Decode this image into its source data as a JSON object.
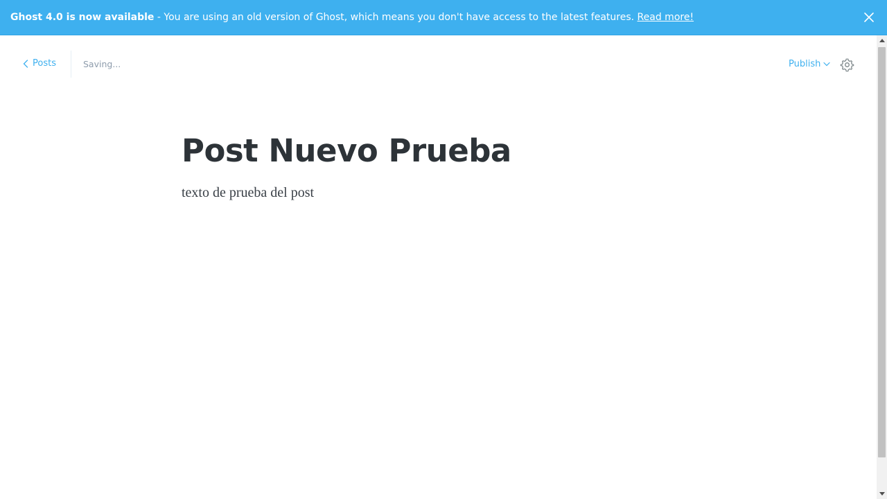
{
  "banner": {
    "bold_text": "Ghost 4.0 is now available",
    "message": " - You are using an old version of Ghost, which means you don't have access to the latest features. ",
    "link_text": "Read more!",
    "close_icon": "close-icon",
    "background_color": "#3eb0ef"
  },
  "topbar": {
    "back_label": "Posts",
    "back_icon": "chevron-left-icon",
    "status": "Saving...",
    "publish_label": "Publish",
    "publish_icon": "chevron-down-icon",
    "settings_icon": "gear-icon",
    "accent_color": "#3eb0ef"
  },
  "post": {
    "title": "Post Nuevo Prueba",
    "body": "texto de prueba del post"
  }
}
